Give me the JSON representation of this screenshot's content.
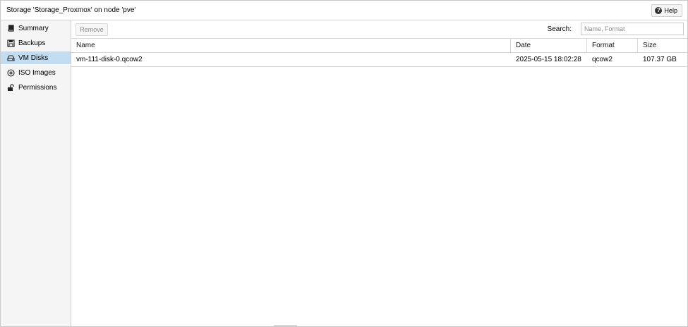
{
  "window": {
    "title": "Storage 'Storage_Proxmox' on node 'pve'",
    "help_label": "Help"
  },
  "sidebar": {
    "items": [
      {
        "label": "Summary",
        "icon": "book-icon"
      },
      {
        "label": "Backups",
        "icon": "floppy-icon"
      },
      {
        "label": "VM Disks",
        "icon": "hdd-icon",
        "active": true
      },
      {
        "label": "ISO Images",
        "icon": "disc-icon"
      },
      {
        "label": "Permissions",
        "icon": "unlock-icon"
      }
    ]
  },
  "toolbar": {
    "remove_label": "Remove",
    "search_label": "Search:",
    "search_placeholder": "Name, Format",
    "search_value": ""
  },
  "grid": {
    "columns": [
      "Name",
      "Date",
      "Format",
      "Size"
    ],
    "rows": [
      {
        "name": "vm-111-disk-0.qcow2",
        "date": "2025-05-15 18:02:28",
        "format": "qcow2",
        "size": "107.37 GB"
      }
    ]
  },
  "colors": {
    "active_nav": "#c2ddf2",
    "sidebar_bg": "#f5f5f5",
    "border": "#d5d5d5"
  }
}
